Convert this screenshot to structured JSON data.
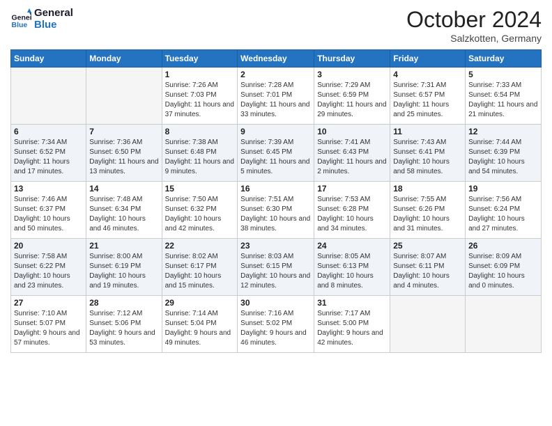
{
  "logo": {
    "line1": "General",
    "line2": "Blue"
  },
  "title": "October 2024",
  "location": "Salzkotten, Germany",
  "days_of_week": [
    "Sunday",
    "Monday",
    "Tuesday",
    "Wednesday",
    "Thursday",
    "Friday",
    "Saturday"
  ],
  "weeks": [
    [
      {
        "day": "",
        "info": ""
      },
      {
        "day": "",
        "info": ""
      },
      {
        "day": "1",
        "info": "Sunrise: 7:26 AM\nSunset: 7:03 PM\nDaylight: 11 hours and 37 minutes."
      },
      {
        "day": "2",
        "info": "Sunrise: 7:28 AM\nSunset: 7:01 PM\nDaylight: 11 hours and 33 minutes."
      },
      {
        "day": "3",
        "info": "Sunrise: 7:29 AM\nSunset: 6:59 PM\nDaylight: 11 hours and 29 minutes."
      },
      {
        "day": "4",
        "info": "Sunrise: 7:31 AM\nSunset: 6:57 PM\nDaylight: 11 hours and 25 minutes."
      },
      {
        "day": "5",
        "info": "Sunrise: 7:33 AM\nSunset: 6:54 PM\nDaylight: 11 hours and 21 minutes."
      }
    ],
    [
      {
        "day": "6",
        "info": "Sunrise: 7:34 AM\nSunset: 6:52 PM\nDaylight: 11 hours and 17 minutes."
      },
      {
        "day": "7",
        "info": "Sunrise: 7:36 AM\nSunset: 6:50 PM\nDaylight: 11 hours and 13 minutes."
      },
      {
        "day": "8",
        "info": "Sunrise: 7:38 AM\nSunset: 6:48 PM\nDaylight: 11 hours and 9 minutes."
      },
      {
        "day": "9",
        "info": "Sunrise: 7:39 AM\nSunset: 6:45 PM\nDaylight: 11 hours and 5 minutes."
      },
      {
        "day": "10",
        "info": "Sunrise: 7:41 AM\nSunset: 6:43 PM\nDaylight: 11 hours and 2 minutes."
      },
      {
        "day": "11",
        "info": "Sunrise: 7:43 AM\nSunset: 6:41 PM\nDaylight: 10 hours and 58 minutes."
      },
      {
        "day": "12",
        "info": "Sunrise: 7:44 AM\nSunset: 6:39 PM\nDaylight: 10 hours and 54 minutes."
      }
    ],
    [
      {
        "day": "13",
        "info": "Sunrise: 7:46 AM\nSunset: 6:37 PM\nDaylight: 10 hours and 50 minutes."
      },
      {
        "day": "14",
        "info": "Sunrise: 7:48 AM\nSunset: 6:34 PM\nDaylight: 10 hours and 46 minutes."
      },
      {
        "day": "15",
        "info": "Sunrise: 7:50 AM\nSunset: 6:32 PM\nDaylight: 10 hours and 42 minutes."
      },
      {
        "day": "16",
        "info": "Sunrise: 7:51 AM\nSunset: 6:30 PM\nDaylight: 10 hours and 38 minutes."
      },
      {
        "day": "17",
        "info": "Sunrise: 7:53 AM\nSunset: 6:28 PM\nDaylight: 10 hours and 34 minutes."
      },
      {
        "day": "18",
        "info": "Sunrise: 7:55 AM\nSunset: 6:26 PM\nDaylight: 10 hours and 31 minutes."
      },
      {
        "day": "19",
        "info": "Sunrise: 7:56 AM\nSunset: 6:24 PM\nDaylight: 10 hours and 27 minutes."
      }
    ],
    [
      {
        "day": "20",
        "info": "Sunrise: 7:58 AM\nSunset: 6:22 PM\nDaylight: 10 hours and 23 minutes."
      },
      {
        "day": "21",
        "info": "Sunrise: 8:00 AM\nSunset: 6:19 PM\nDaylight: 10 hours and 19 minutes."
      },
      {
        "day": "22",
        "info": "Sunrise: 8:02 AM\nSunset: 6:17 PM\nDaylight: 10 hours and 15 minutes."
      },
      {
        "day": "23",
        "info": "Sunrise: 8:03 AM\nSunset: 6:15 PM\nDaylight: 10 hours and 12 minutes."
      },
      {
        "day": "24",
        "info": "Sunrise: 8:05 AM\nSunset: 6:13 PM\nDaylight: 10 hours and 8 minutes."
      },
      {
        "day": "25",
        "info": "Sunrise: 8:07 AM\nSunset: 6:11 PM\nDaylight: 10 hours and 4 minutes."
      },
      {
        "day": "26",
        "info": "Sunrise: 8:09 AM\nSunset: 6:09 PM\nDaylight: 10 hours and 0 minutes."
      }
    ],
    [
      {
        "day": "27",
        "info": "Sunrise: 7:10 AM\nSunset: 5:07 PM\nDaylight: 9 hours and 57 minutes."
      },
      {
        "day": "28",
        "info": "Sunrise: 7:12 AM\nSunset: 5:06 PM\nDaylight: 9 hours and 53 minutes."
      },
      {
        "day": "29",
        "info": "Sunrise: 7:14 AM\nSunset: 5:04 PM\nDaylight: 9 hours and 49 minutes."
      },
      {
        "day": "30",
        "info": "Sunrise: 7:16 AM\nSunset: 5:02 PM\nDaylight: 9 hours and 46 minutes."
      },
      {
        "day": "31",
        "info": "Sunrise: 7:17 AM\nSunset: 5:00 PM\nDaylight: 9 hours and 42 minutes."
      },
      {
        "day": "",
        "info": ""
      },
      {
        "day": "",
        "info": ""
      }
    ]
  ]
}
